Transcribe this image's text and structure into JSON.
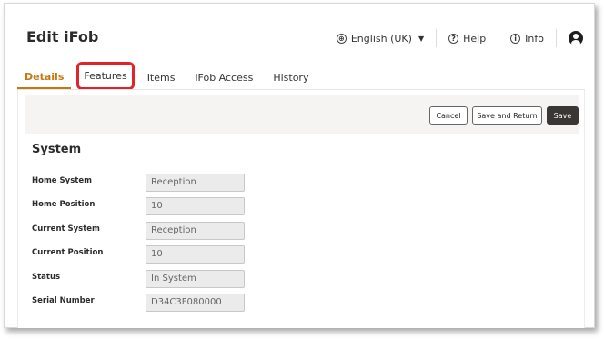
{
  "header": {
    "title": "Edit iFob",
    "language": "English (UK)",
    "help": "Help",
    "info": "Info"
  },
  "tabs": [
    {
      "label": "Details"
    },
    {
      "label": "Features"
    },
    {
      "label": "Items"
    },
    {
      "label": "iFob Access"
    },
    {
      "label": "History"
    }
  ],
  "actions": {
    "cancel": "Cancel",
    "save_return": "Save and Return",
    "save": "Save"
  },
  "section": {
    "title": "System"
  },
  "fields": [
    {
      "label": "Home System",
      "value": "Reception"
    },
    {
      "label": "Home Position",
      "value": "10"
    },
    {
      "label": "Current System",
      "value": "Reception"
    },
    {
      "label": "Current Position",
      "value": "10"
    },
    {
      "label": "Status",
      "value": "In System"
    },
    {
      "label": "Serial Number",
      "value": "D34C3F080000"
    }
  ],
  "colors": {
    "accent": "#c8760f",
    "highlight": "#e0252a",
    "primary_button": "#3a3633"
  }
}
